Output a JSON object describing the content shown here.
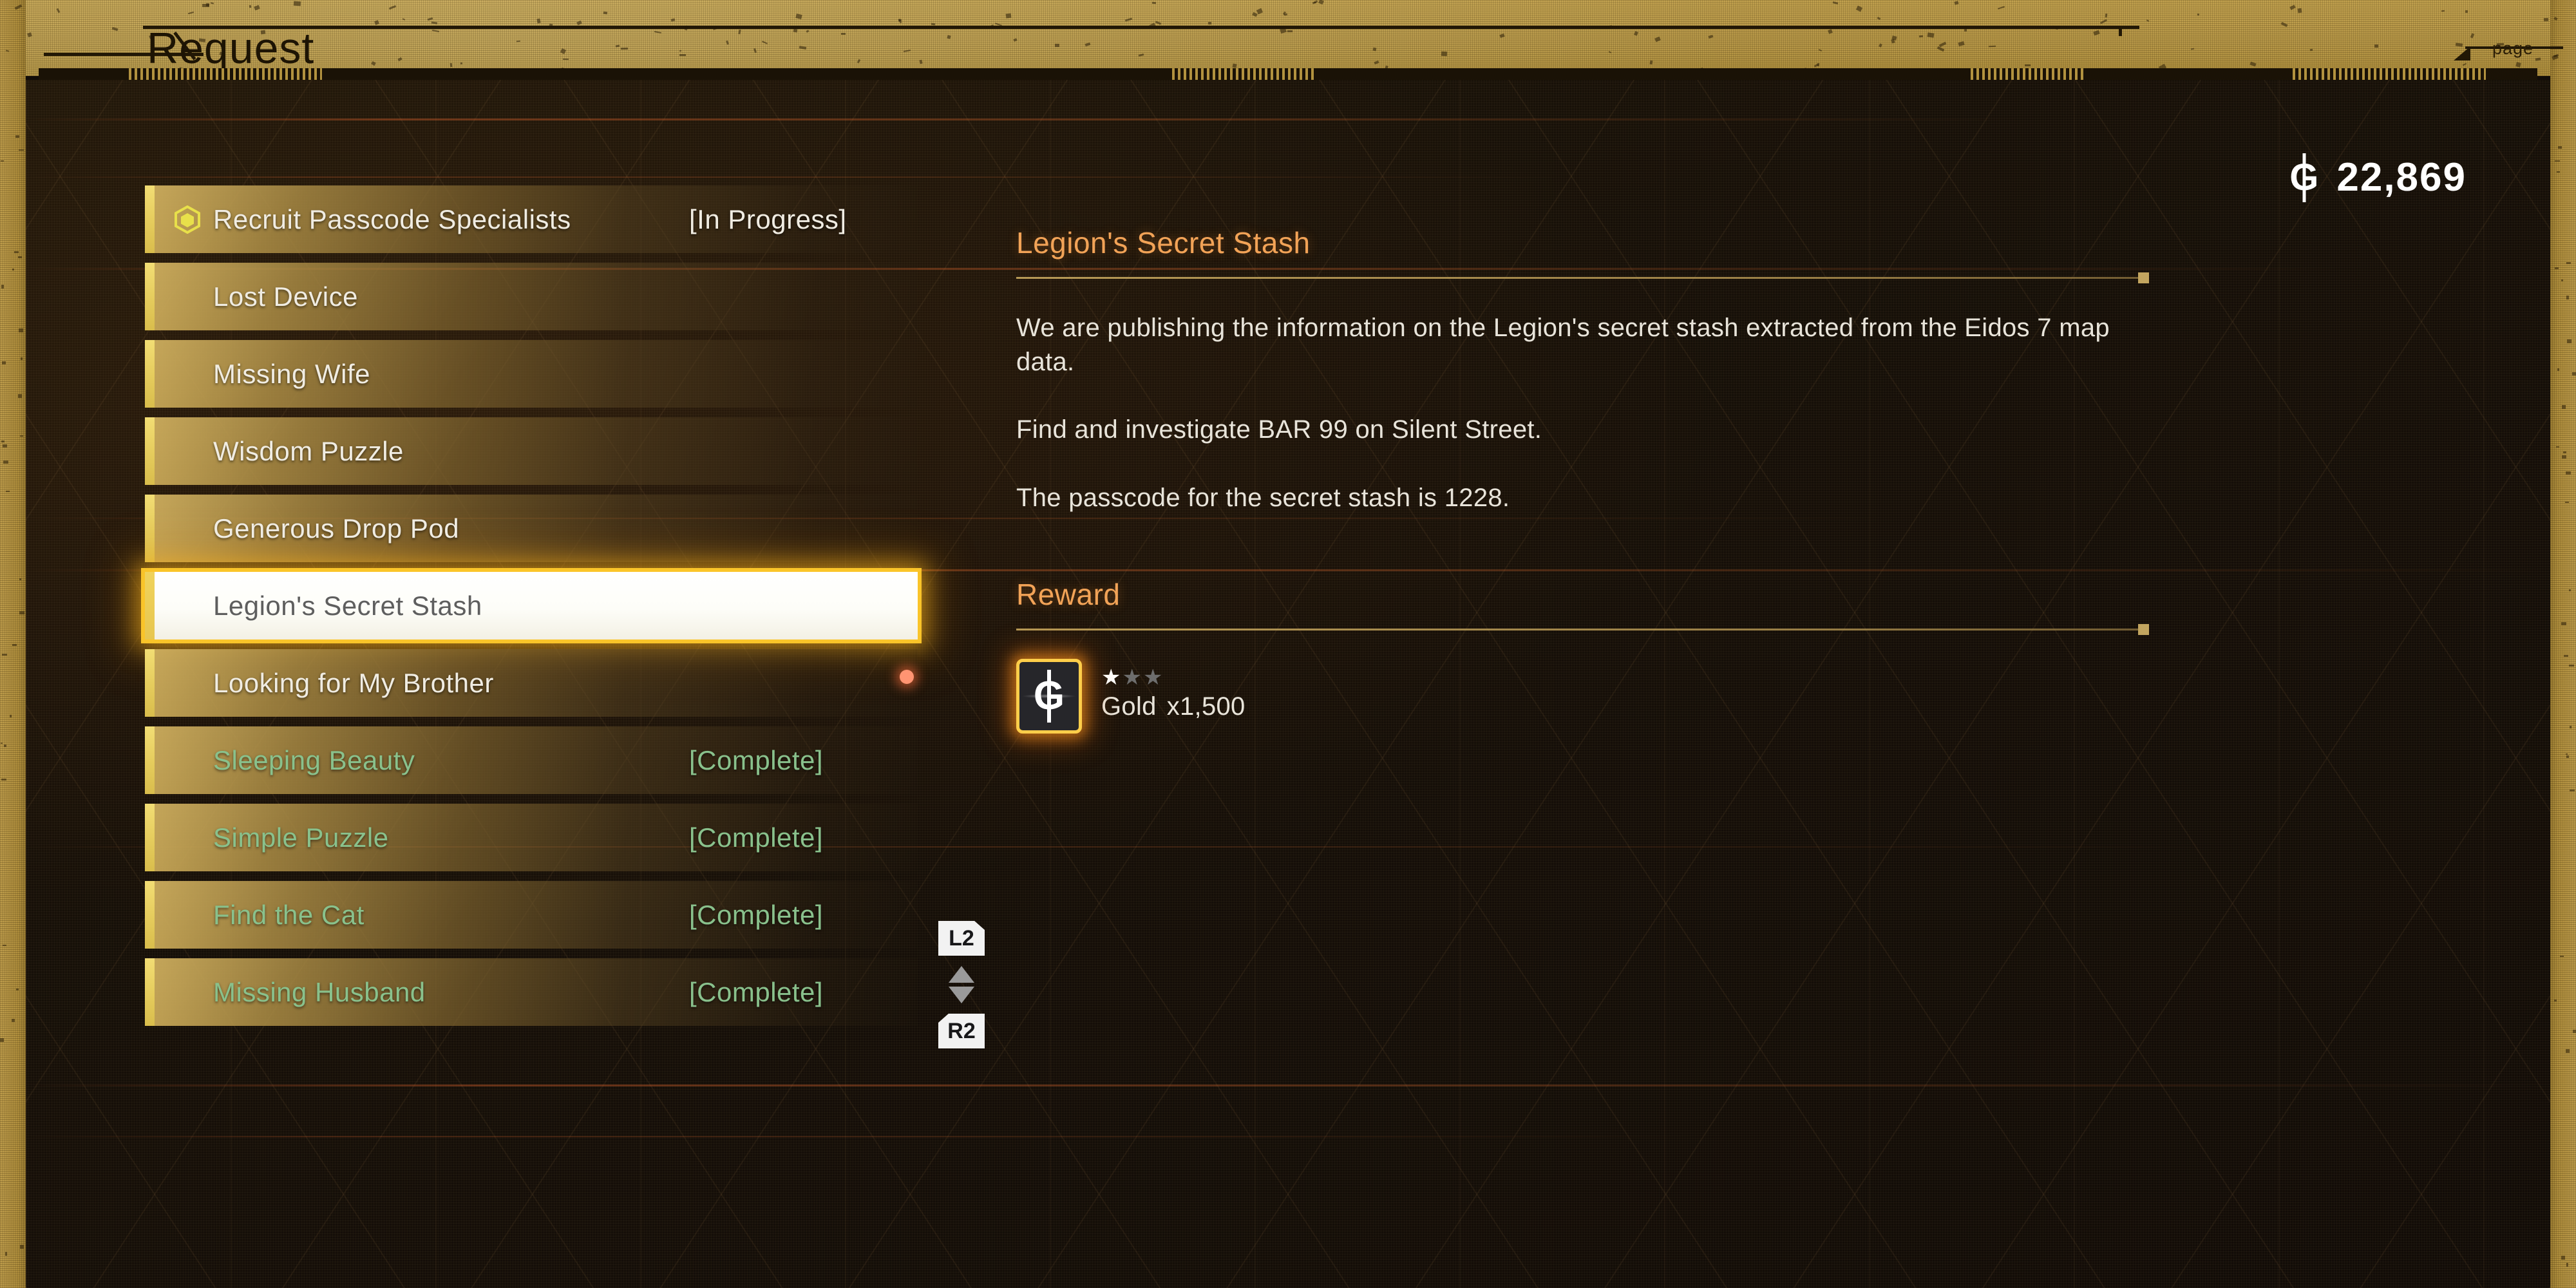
{
  "header": {
    "title": "Request",
    "page_label": "page"
  },
  "currency": {
    "symbol": "G",
    "amount": "22,869"
  },
  "quest_list": {
    "items": [
      {
        "label": "Recruit Passcode Specialists",
        "status": "[In Progress]",
        "state": "in-progress",
        "icon": "hexagon-active-icon",
        "selected": false,
        "has_new_dot": false
      },
      {
        "label": "Lost Device",
        "status": "",
        "state": "available",
        "icon": "",
        "selected": false,
        "has_new_dot": false
      },
      {
        "label": "Missing Wife",
        "status": "",
        "state": "available",
        "icon": "",
        "selected": false,
        "has_new_dot": false
      },
      {
        "label": "Wisdom Puzzle",
        "status": "",
        "state": "available",
        "icon": "",
        "selected": false,
        "has_new_dot": false
      },
      {
        "label": "Generous Drop Pod",
        "status": "",
        "state": "available",
        "icon": "",
        "selected": false,
        "has_new_dot": false
      },
      {
        "label": "Legion's Secret Stash",
        "status": "",
        "state": "available",
        "icon": "",
        "selected": true,
        "has_new_dot": false
      },
      {
        "label": "Looking for My Brother",
        "status": "",
        "state": "available",
        "icon": "",
        "selected": false,
        "has_new_dot": true
      },
      {
        "label": "Sleeping Beauty",
        "status": "[Complete]",
        "state": "complete",
        "icon": "",
        "selected": false,
        "has_new_dot": false
      },
      {
        "label": "Simple Puzzle",
        "status": "[Complete]",
        "state": "complete",
        "icon": "",
        "selected": false,
        "has_new_dot": false
      },
      {
        "label": "Find the Cat",
        "status": "[Complete]",
        "state": "complete",
        "icon": "",
        "selected": false,
        "has_new_dot": false
      },
      {
        "label": "Missing Husband",
        "status": "[Complete]",
        "state": "complete",
        "icon": "",
        "selected": false,
        "has_new_dot": false
      }
    ]
  },
  "pad_hints": {
    "prev_key": "L2",
    "next_key": "R2"
  },
  "detail": {
    "title": "Legion's Secret Stash",
    "paragraphs": [
      "We are publishing the information on the Legion's secret stash extracted from the Eidos 7 map data.",
      "Find and investigate BAR 99 on Silent Street.",
      "The passcode for the secret stash is 1228."
    ],
    "reward_heading": "Reward",
    "reward": {
      "icon_symbol": "G",
      "icon_name": "gold-currency-icon",
      "rarity_filled": 1,
      "rarity_total": 3,
      "name": "Gold",
      "quantity": "x1,500"
    }
  },
  "colors": {
    "gold_frame": "#b5933f",
    "accent_orange": "#f2a357",
    "complete_green": "#89c18c",
    "item_accent": "#e6cd5e",
    "new_dot": "#ff9472"
  }
}
